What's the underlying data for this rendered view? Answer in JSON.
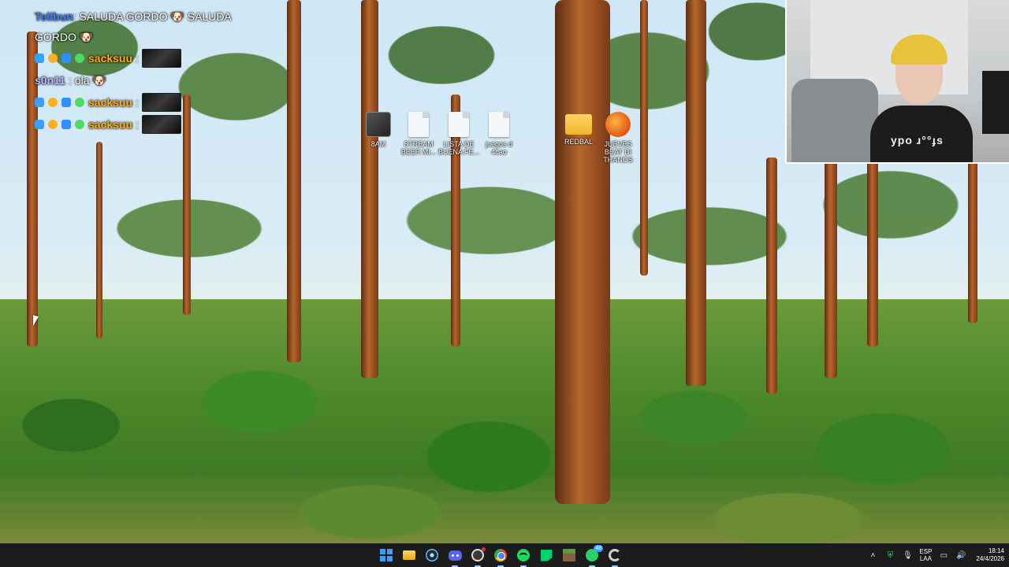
{
  "chat": {
    "messages": [
      {
        "user": "Telibun",
        "sep": ":",
        "text": "SALUDA GORDO 🐶 SALUDA GORDO 🐶",
        "color": "#3d7dff"
      },
      {
        "user": "sacksuu",
        "sep": ":",
        "text": "",
        "color": "#ffb020",
        "has_emote": true
      },
      {
        "user": "s0n11",
        "sep": ":",
        "text": "ola 🐶",
        "color": "#b9b6ff"
      },
      {
        "user": "sacksuu",
        "sep": ":",
        "text": "",
        "color": "#ffb020",
        "has_emote": true
      },
      {
        "user": "sacksuu",
        "sep": ":",
        "text": "",
        "color": "#ffb020",
        "has_emote": true
      }
    ]
  },
  "desktop_icons": [
    {
      "label": "8AM",
      "icon": "app-thumbnail-icon"
    },
    {
      "label": "STREAM BEER MI...",
      "icon": "text-file-icon"
    },
    {
      "label": "LISTA DE BUENA FE...",
      "icon": "text-file-icon"
    },
    {
      "label": "juegos d 4cao",
      "icon": "text-file-icon"
    },
    {
      "label": "REDBAL",
      "icon": "folder-icon"
    },
    {
      "label": "JUEVES BEAT DI THANOS",
      "icon": "fl-studio-icon"
    }
  ],
  "webcam": {
    "shirt_text": "ypo ɹ°°ɟs"
  },
  "taskbar": {
    "apps": [
      {
        "name": "start-button",
        "icon": "windows-icon"
      },
      {
        "name": "file-explorer",
        "icon": "folder-icon"
      },
      {
        "name": "steam",
        "icon": "steam-icon"
      },
      {
        "name": "discord",
        "icon": "discord-icon"
      },
      {
        "name": "obs",
        "icon": "obs-icon"
      },
      {
        "name": "chrome",
        "icon": "chrome-icon"
      },
      {
        "name": "spotify",
        "icon": "spotify-icon"
      },
      {
        "name": "kick",
        "icon": "kick-icon"
      },
      {
        "name": "minecraft",
        "icon": "minecraft-icon"
      },
      {
        "name": "whatsapp",
        "icon": "whatsapp-icon",
        "badge": "48"
      },
      {
        "name": "app",
        "icon": "app-icon"
      }
    ],
    "tray": {
      "chevron": "˄",
      "lang_line1": "ESP",
      "lang_line2": "LAA",
      "time": "18:14",
      "date": "24/4/2026"
    }
  },
  "colors": {
    "taskbar_bg": "#1c1c1c",
    "accent": "#3aa0ff"
  }
}
